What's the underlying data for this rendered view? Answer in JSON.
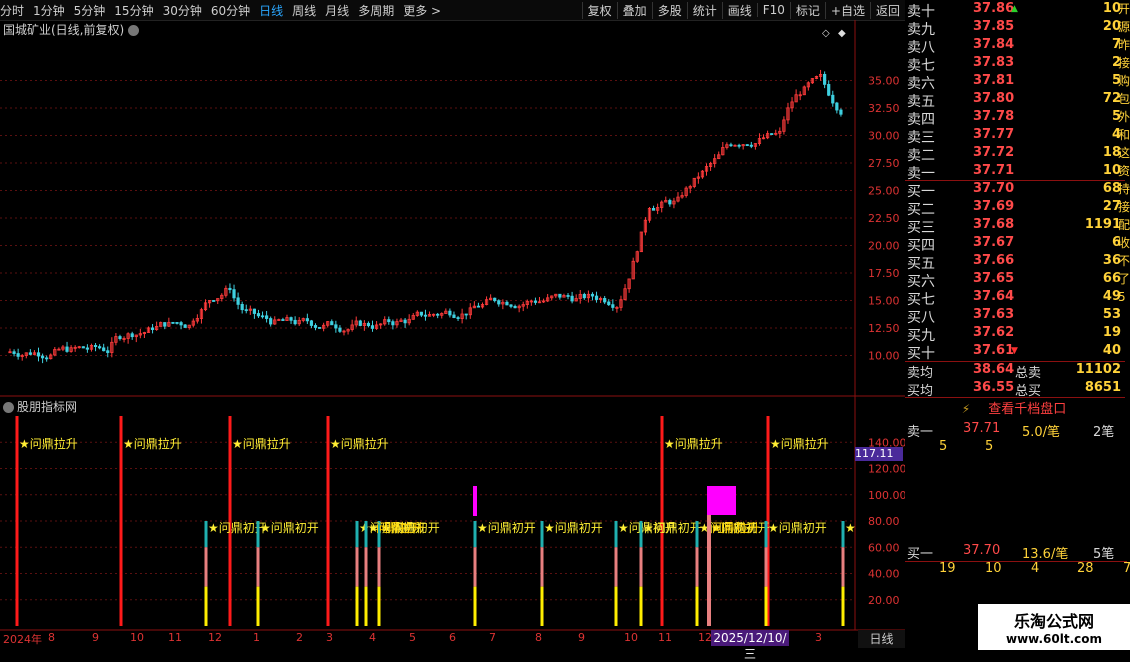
{
  "toolbar": {
    "left": [
      "分时",
      "1分钟",
      "5分钟",
      "15分钟",
      "30分钟",
      "60分钟",
      "日线",
      "周线",
      "月线",
      "多周期",
      "更多 >"
    ],
    "active": "日线",
    "right": [
      "复权",
      "叠加",
      "多股",
      "统计",
      "画线",
      "F10",
      "标记",
      "+自选",
      "返回"
    ]
  },
  "chart": {
    "title": "国城矿业(日线,前复权)",
    "price_ticks": [
      "35.00",
      "32.50",
      "30.00",
      "27.50",
      "25.00",
      "22.50",
      "20.00",
      "17.50",
      "15.00",
      "12.50",
      "10.00"
    ],
    "price_range": [
      8.5,
      38.5
    ],
    "colors": {
      "up": "#ff3b3b",
      "down": "#3fd0e0",
      "grid": "#5a1010"
    }
  },
  "indicator": {
    "title": "股朋指标网",
    "ticks": [
      "140.00",
      "120.00",
      "100.00",
      "80.00",
      "60.00",
      "40.00",
      "20.00"
    ],
    "current_value": "117.11",
    "signal_lift": "★问鼎拉升",
    "signal_start": "★问鼎初开",
    "overlap_text": "问鼎拉升",
    "lone_star": "★"
  },
  "xaxis": {
    "labels": [
      "2024年",
      "8",
      "9",
      "10",
      "11",
      "12",
      "1",
      "2",
      "3",
      "4",
      "5",
      "6",
      "7",
      "8",
      "9",
      "10",
      "11",
      "12",
      "2",
      "3"
    ],
    "date_badge": "2025/12/10/三",
    "timeframe": "日线"
  },
  "orderbook": {
    "sells": [
      {
        "label": "卖十",
        "price": "37.86",
        "vol": "10",
        "mark": "up"
      },
      {
        "label": "卖九",
        "price": "37.85",
        "vol": "20"
      },
      {
        "label": "卖八",
        "price": "37.84",
        "vol": "7"
      },
      {
        "label": "卖七",
        "price": "37.83",
        "vol": "2"
      },
      {
        "label": "卖六",
        "price": "37.81",
        "vol": "5"
      },
      {
        "label": "卖五",
        "price": "37.80",
        "vol": "72"
      },
      {
        "label": "卖四",
        "price": "37.78",
        "vol": "5"
      },
      {
        "label": "卖三",
        "price": "37.77",
        "vol": "4"
      },
      {
        "label": "卖二",
        "price": "37.72",
        "vol": "18"
      },
      {
        "label": "卖一",
        "price": "37.71",
        "vol": "10"
      }
    ],
    "buys": [
      {
        "label": "买一",
        "price": "37.70",
        "vol": "68"
      },
      {
        "label": "买二",
        "price": "37.69",
        "vol": "27"
      },
      {
        "label": "买三",
        "price": "37.68",
        "vol": "1191"
      },
      {
        "label": "买四",
        "price": "37.67",
        "vol": "6"
      },
      {
        "label": "买五",
        "price": "37.66",
        "vol": "36"
      },
      {
        "label": "买六",
        "price": "37.65",
        "vol": "66"
      },
      {
        "label": "买七",
        "price": "37.64",
        "vol": "49"
      },
      {
        "label": "买八",
        "price": "37.63",
        "vol": "53"
      },
      {
        "label": "买九",
        "price": "37.62",
        "vol": "19"
      },
      {
        "label": "买十",
        "price": "37.61",
        "vol": "40",
        "mark": "down"
      }
    ],
    "summary": [
      {
        "l1": "卖均",
        "p": "38.64",
        "l2": "总卖",
        "v": "11102"
      },
      {
        "l1": "买均",
        "p": "36.55",
        "l2": "总买",
        "v": "8651"
      }
    ]
  },
  "panel_button": "查看千档盘口",
  "sell1_detail": {
    "label": "卖一",
    "price": "37.71",
    "per": "5.0/笔",
    "count": "2笔",
    "nums": [
      "5",
      "5"
    ]
  },
  "buy1_detail": {
    "label": "买一",
    "price": "37.70",
    "per": "13.6/笔",
    "count": "5笔",
    "nums": [
      "19",
      "10",
      "4",
      "28",
      "7"
    ]
  },
  "edge_text": "开源昨接购包外和这资持接配收不了5",
  "watermark": {
    "name": "乐淘公式网",
    "url": "www.60lt.com"
  }
}
